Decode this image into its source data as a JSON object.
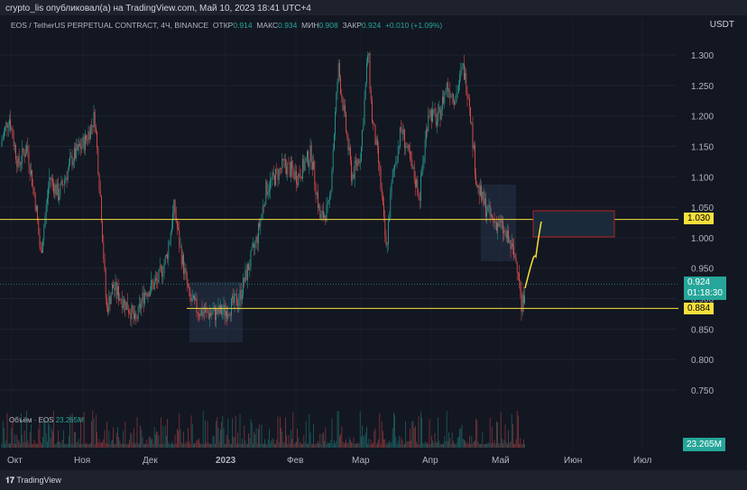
{
  "publisher": "crypto_lis опубликовал(а) на TradingView.com, Май 10, 2023 18:41 UTC+4",
  "legend": {
    "symbol": "EOS / TetherUS PERPETUAL CONTRACT, 4Ч, BINANCE",
    "open_label": "ОТКР",
    "open": "0.914",
    "high_label": "МАКС",
    "high": "0.934",
    "low_label": "МИН",
    "low": "0.908",
    "close_label": "ЗАКР",
    "close": "0.924",
    "change": "+0.010 (+1.09%)"
  },
  "currency": "USDT",
  "price_badges": {
    "current": "0.924",
    "countdown": "01:18:30",
    "level_high": "1.030",
    "level_low": "0.884"
  },
  "volume": {
    "label": "Объём · EOS",
    "value": "23.265M",
    "badge": "23.265M"
  },
  "brand": "TradingView",
  "colors": {
    "up": "#26a69a",
    "down": "#ef5350",
    "level": "#f8e03c",
    "zone": "#b22222"
  },
  "chart_data": {
    "type": "candlestick",
    "yaxis_ticks": [
      "1.300",
      "1.250",
      "1.200",
      "1.150",
      "1.100",
      "1.050",
      "1.000",
      "0.950",
      "0.900",
      "0.850",
      "0.800",
      "0.750"
    ],
    "ylim": [
      0.7,
      1.35
    ],
    "xaxis_ticks": [
      "Окт",
      "Ноя",
      "Дек",
      "2023",
      "Фев",
      "Мар",
      "Апр",
      "Май",
      "Июн",
      "Июл"
    ],
    "close_path": [
      [
        0,
        1.15
      ],
      [
        10,
        1.2
      ],
      [
        20,
        1.12
      ],
      [
        30,
        1.15
      ],
      [
        40,
        1.05
      ],
      [
        45,
        0.97
      ],
      [
        55,
        1.1
      ],
      [
        65,
        1.07
      ],
      [
        80,
        1.13
      ],
      [
        95,
        1.16
      ],
      [
        105,
        1.2
      ],
      [
        112,
        1.05
      ],
      [
        118,
        0.88
      ],
      [
        125,
        0.92
      ],
      [
        135,
        0.9
      ],
      [
        145,
        0.88
      ],
      [
        150,
        0.86
      ],
      [
        160,
        0.91
      ],
      [
        175,
        0.93
      ],
      [
        185,
        0.97
      ],
      [
        193,
        1.05
      ],
      [
        200,
        0.98
      ],
      [
        210,
        0.9
      ],
      [
        220,
        0.88
      ],
      [
        235,
        0.875
      ],
      [
        250,
        0.88
      ],
      [
        265,
        0.9
      ],
      [
        275,
        0.95
      ],
      [
        285,
        1.0
      ],
      [
        295,
        1.08
      ],
      [
        305,
        1.1
      ],
      [
        315,
        1.12
      ],
      [
        330,
        1.1
      ],
      [
        345,
        1.14
      ],
      [
        355,
        1.03
      ],
      [
        365,
        1.05
      ],
      [
        375,
        1.28
      ],
      [
        380,
        1.22
      ],
      [
        390,
        1.1
      ],
      [
        400,
        1.14
      ],
      [
        408,
        1.31
      ],
      [
        412,
        1.2
      ],
      [
        420,
        1.12
      ],
      [
        428,
        0.98
      ],
      [
        435,
        1.1
      ],
      [
        445,
        1.18
      ],
      [
        455,
        1.12
      ],
      [
        465,
        1.07
      ],
      [
        475,
        1.21
      ],
      [
        485,
        1.19
      ],
      [
        495,
        1.25
      ],
      [
        505,
        1.23
      ],
      [
        513,
        1.28
      ],
      [
        520,
        1.23
      ],
      [
        528,
        1.09
      ],
      [
        535,
        1.06
      ],
      [
        545,
        1.03
      ],
      [
        555,
        1.02
      ],
      [
        565,
        0.99
      ],
      [
        575,
        0.95
      ],
      [
        578,
        0.88
      ],
      [
        582,
        0.924
      ]
    ],
    "levels": [
      1.03,
      0.884
    ],
    "current_price": 0.924
  }
}
